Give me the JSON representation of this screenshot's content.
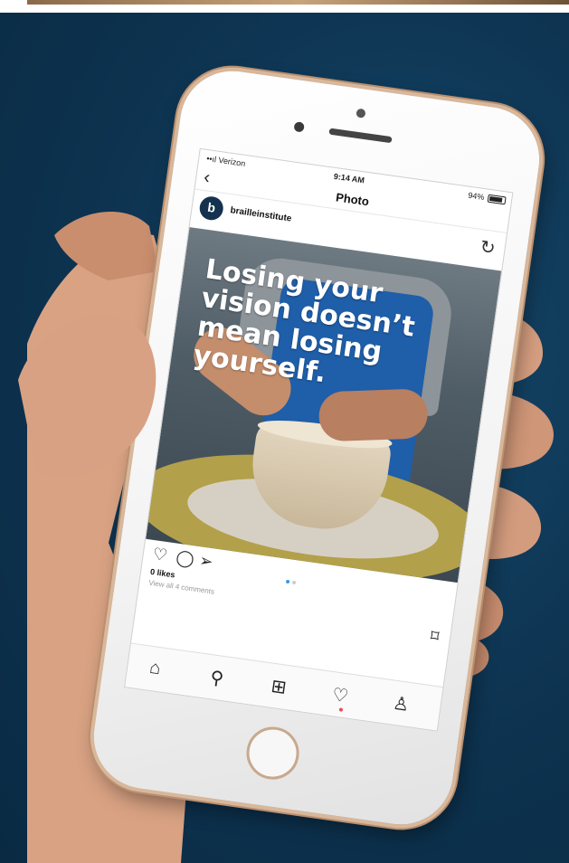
{
  "status_bar": {
    "carrier": "••ıl Verizon",
    "time": "9:14 AM",
    "battery": "94%"
  },
  "nav": {
    "back_icon": "‹",
    "title": "Photo"
  },
  "post": {
    "avatar_letter": "b",
    "username": "brailleinstitute",
    "refresh_icon": "↻",
    "more_icon": "•••",
    "overlay_text": "Losing your\nvision doesn’t\nmean losing\nyourself.",
    "likes": "0 likes",
    "comments_link": "View all 4 comments"
  },
  "actions": {
    "heart_icon": "♡",
    "comment_icon": "◯",
    "share_icon": "➢",
    "bookmark_icon": "⌑"
  },
  "tabs": {
    "home_icon": "⌂",
    "search_icon": "⚲",
    "add_icon": "⊞",
    "activity_icon": "♡",
    "profile_icon": "♙"
  },
  "colors": {
    "background": "#0d3350",
    "avatar": "#14324f",
    "active_dot": "#3897f0",
    "notification_dot": "#ed4956"
  }
}
